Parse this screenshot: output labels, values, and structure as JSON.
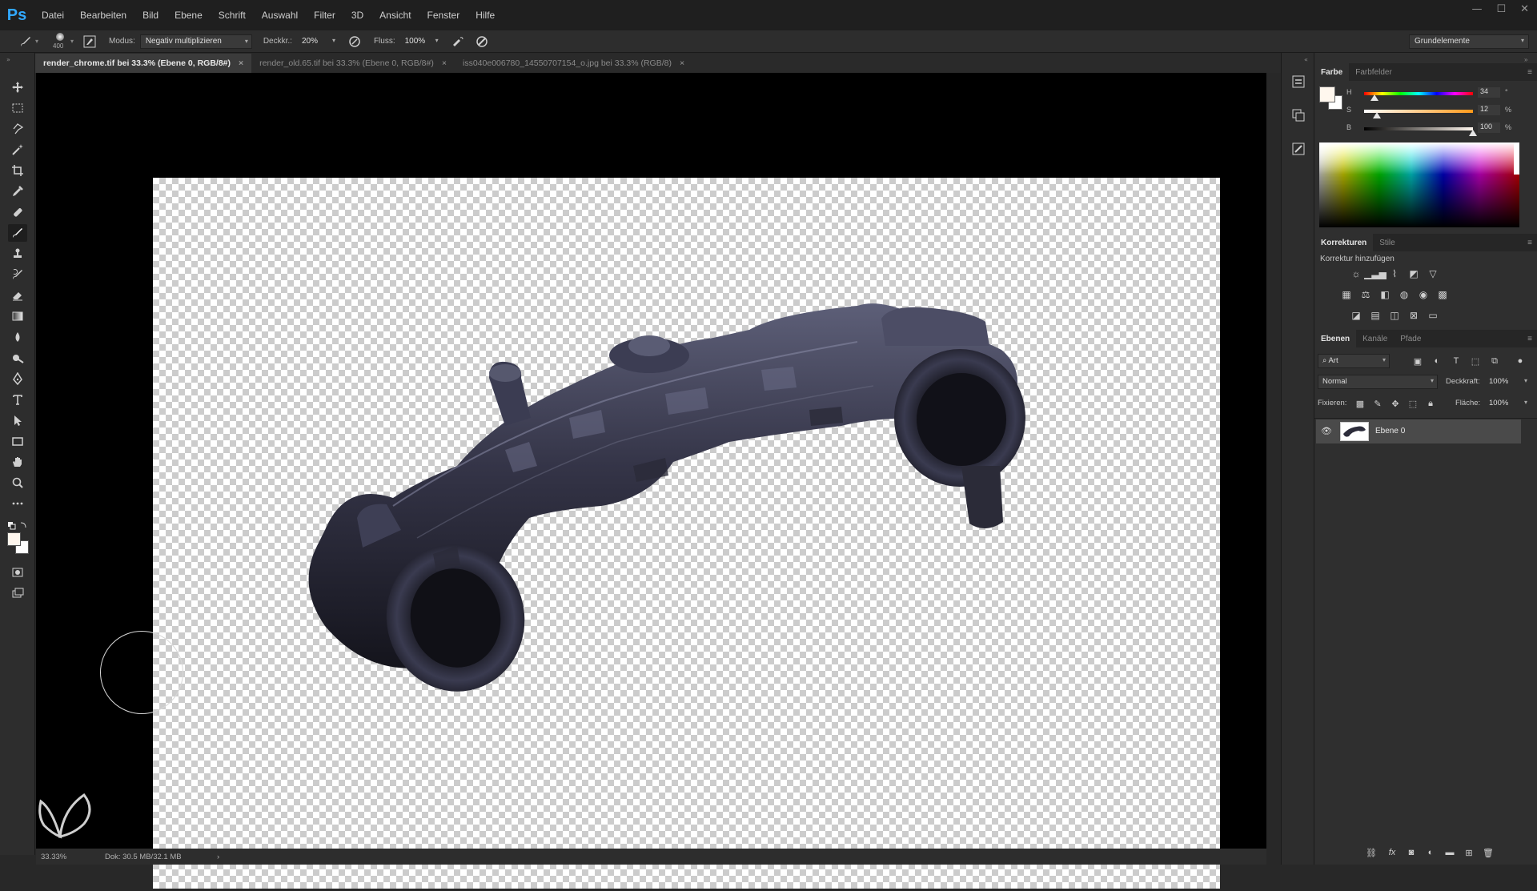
{
  "app": {
    "logo": "Ps"
  },
  "menu": [
    "Datei",
    "Bearbeiten",
    "Bild",
    "Ebene",
    "Schrift",
    "Auswahl",
    "Filter",
    "3D",
    "Ansicht",
    "Fenster",
    "Hilfe"
  ],
  "window_controls": {
    "minimize": "—",
    "maximize": "☐",
    "close": "✕"
  },
  "options": {
    "brush_size": "400",
    "mode_label": "Modus:",
    "mode_value": "Negativ multiplizieren",
    "opacity_label": "Deckkr.:",
    "opacity_value": "20%",
    "flow_label": "Fluss:",
    "flow_value": "100%",
    "workspace": "Grundelemente"
  },
  "tabs": [
    {
      "label": "render_chrome.tif bei 33.3% (Ebene 0, RGB/8#)",
      "active": true
    },
    {
      "label": "render_old.65.tif bei 33.3% (Ebene 0, RGB/8#)",
      "active": false
    },
    {
      "label": "iss040e006780_14550707154_o.jpg bei 33.3% (RGB/8)",
      "active": false
    }
  ],
  "tab_close": "×",
  "status": {
    "zoom": "33.33%",
    "doc": "Dok: 30.5 MB/32.1 MB",
    "arrow": "›"
  },
  "color_panel": {
    "tabs": [
      "Farbe",
      "Farbfelder"
    ],
    "sliders": [
      {
        "label": "H",
        "value": "34",
        "unit": "°",
        "fraction": 0.094
      },
      {
        "label": "S",
        "value": "12",
        "unit": "%",
        "fraction": 0.12
      },
      {
        "label": "B",
        "value": "100",
        "unit": "%",
        "fraction": 1.0
      }
    ],
    "foreground": "#fff7ee",
    "background": "#ffffff"
  },
  "adjustments": {
    "tabs": [
      "Korrekturen",
      "Stile"
    ],
    "heading": "Korrektur hinzufügen",
    "row1": [
      "brightness-icon",
      "levels-icon",
      "curves-icon",
      "exposure-icon",
      "vibrance-icon"
    ],
    "row2": [
      "hue-saturation-icon",
      "color-balance-icon",
      "black-white-icon",
      "photo-filter-icon",
      "channel-mixer-icon",
      "color-lookup-icon"
    ],
    "row3": [
      "invert-icon",
      "posterize-icon",
      "threshold-icon",
      "selective-color-icon",
      "gradient-map-icon"
    ]
  },
  "layers": {
    "tabs": [
      "Ebenen",
      "Kanäle",
      "Pfade"
    ],
    "filter_value": "Art",
    "blend_mode": "Normal",
    "opacity_label": "Deckkraft:",
    "opacity_value": "100%",
    "lock_label": "Fixieren:",
    "fill_label": "Fläche:",
    "fill_value": "100%",
    "items": [
      {
        "name": "Ebene 0",
        "visible": true
      }
    ]
  }
}
